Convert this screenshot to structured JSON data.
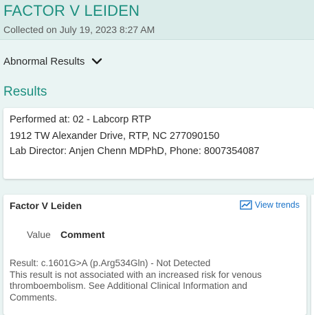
{
  "header": {
    "title": "FACTOR V LEIDEN",
    "collected": "Collected on July 19, 2023 8:27 AM"
  },
  "abnormal": {
    "label": "Abnormal Results",
    "icon": "chevron-down-icon"
  },
  "results": {
    "section_title": "Results",
    "performed": {
      "line1": "Performed at: 02 - Labcorp RTP",
      "line2": "1912 TW Alexander Drive, RTP, NC 277090150",
      "line3": "Lab Director: Anjen Chenn MDPhD, Phone: 8007354087"
    },
    "component": {
      "name": "Factor V Leiden",
      "trends_label": "View trends",
      "trends_icon": "trend-chart-icon",
      "columns": [
        "Value",
        "Comment"
      ],
      "comment_lines": [
        "Result: c.1601G>A (p.Arg534Gln) - Not Detected",
        "This result is not associated with an increased risk for venous",
        "thromboembolism. See Additional Clinical Information and",
        "Comments."
      ]
    }
  },
  "colors": {
    "accent": "#1d8f7f",
    "link": "#1a73c9",
    "background": "#eaf4f3",
    "header_background": "#dbecea"
  }
}
